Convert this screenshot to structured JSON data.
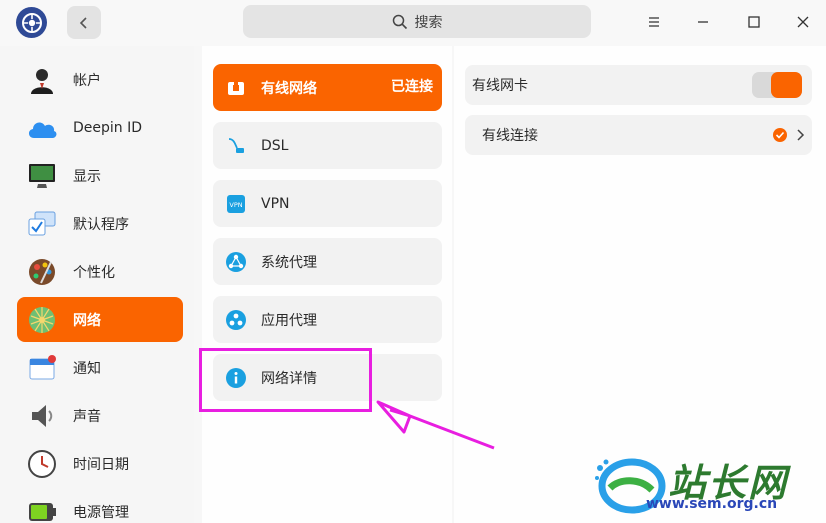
{
  "search": {
    "placeholder": "搜索"
  },
  "sidebar": {
    "items": [
      {
        "label": "帐户",
        "icon": "account-icon"
      },
      {
        "label": "Deepin ID",
        "icon": "cloud-icon"
      },
      {
        "label": "显示",
        "icon": "monitor-icon"
      },
      {
        "label": "默认程序",
        "icon": "default-apps-icon"
      },
      {
        "label": "个性化",
        "icon": "palette-icon"
      },
      {
        "label": "网络",
        "icon": "network-globe-icon",
        "active": true
      },
      {
        "label": "通知",
        "icon": "notification-icon"
      },
      {
        "label": "声音",
        "icon": "speaker-icon"
      },
      {
        "label": "时间日期",
        "icon": "clock-icon"
      },
      {
        "label": "电源管理",
        "icon": "battery-icon"
      }
    ]
  },
  "network_menu": {
    "items": [
      {
        "label": "有线网络",
        "status": "已连接",
        "icon": "wired-network-icon",
        "active": true
      },
      {
        "label": "DSL",
        "icon": "dsl-icon"
      },
      {
        "label": "VPN",
        "icon": "vpn-icon"
      },
      {
        "label": "系统代理",
        "icon": "system-proxy-icon"
      },
      {
        "label": "应用代理",
        "icon": "app-proxy-icon"
      },
      {
        "label": "网络详情",
        "icon": "info-icon"
      }
    ]
  },
  "wired": {
    "card_label": "有线网卡",
    "card_enabled": true,
    "connection_label": "有线连接",
    "connection_active": true
  },
  "watermark": {
    "text": "站长网",
    "url": "www.sem.org.cn"
  },
  "colors": {
    "accent": "#fa6400",
    "annotation": "#e81ee0",
    "info_blue": "#1aa0e0"
  }
}
